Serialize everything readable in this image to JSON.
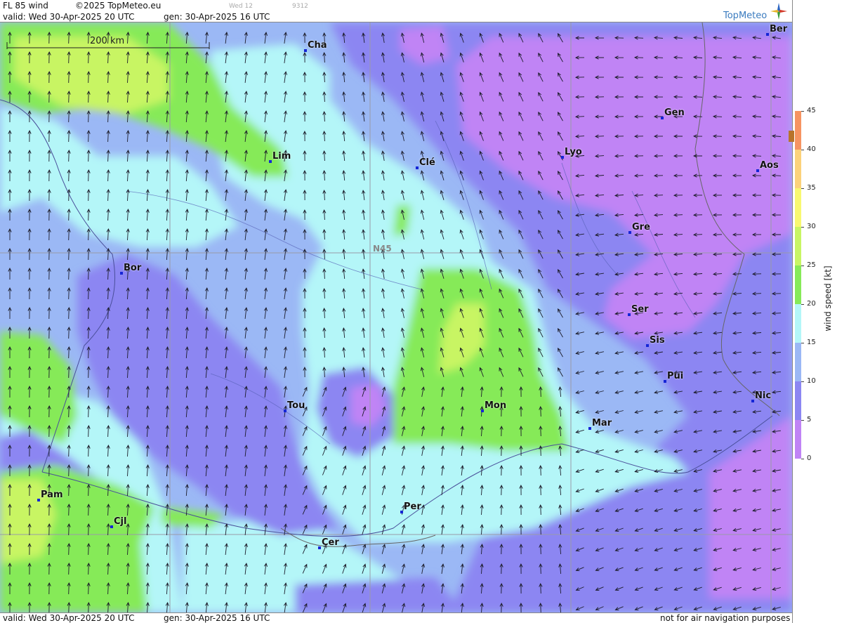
{
  "header": {
    "product": "FL 85 wind",
    "copyright": "©2025 TopMeteo.eu",
    "day_small": "Wed 12",
    "code_small": "9312",
    "valid_text": "valid:  Wed  30-Apr-2025  20 UTC",
    "gen_text": "gen: 30-Apr-2025 16 UTC",
    "logo": "TopMeteo",
    "logo_icon": "compass-star-icon"
  },
  "map": {
    "scale_label": "200 km",
    "graticule_label": "N45",
    "cities": [
      {
        "name": "Cha"
      },
      {
        "name": "Lim"
      },
      {
        "name": "Clé"
      },
      {
        "name": "Lyo"
      },
      {
        "name": "Gen"
      },
      {
        "name": "Ber"
      },
      {
        "name": "Aos"
      },
      {
        "name": "Gre"
      },
      {
        "name": "Bor"
      },
      {
        "name": "Ser"
      },
      {
        "name": "Sis"
      },
      {
        "name": "Pui"
      },
      {
        "name": "Tou"
      },
      {
        "name": "Mon"
      },
      {
        "name": "Mar"
      },
      {
        "name": "Nic"
      },
      {
        "name": "Pam"
      },
      {
        "name": "Cjl"
      },
      {
        "name": "Per"
      },
      {
        "name": "Cer"
      }
    ]
  },
  "footer": {
    "valid_text": "valid:  Wed  30-Apr-2025  20 UTC",
    "gen_text": "gen: 30-Apr-2025 16 UTC",
    "disclaimer": "not for air navigation purposes"
  },
  "legend": {
    "title": "wind speed [kt]",
    "ticks": [
      "45",
      "40",
      "35",
      "30",
      "25",
      "20",
      "15",
      "10",
      "5",
      "0"
    ],
    "colors": {
      "0-5": "#c084f5",
      "5-10": "#8c86f2",
      "10-15": "#9bb8f5",
      "15-20": "#b4f6f8",
      "20-25": "#86ea58",
      "25-30": "#c8f564",
      "30-35": "#f8f870",
      "35-40": "#fcd27a",
      "40-45": "#f69462"
    }
  }
}
